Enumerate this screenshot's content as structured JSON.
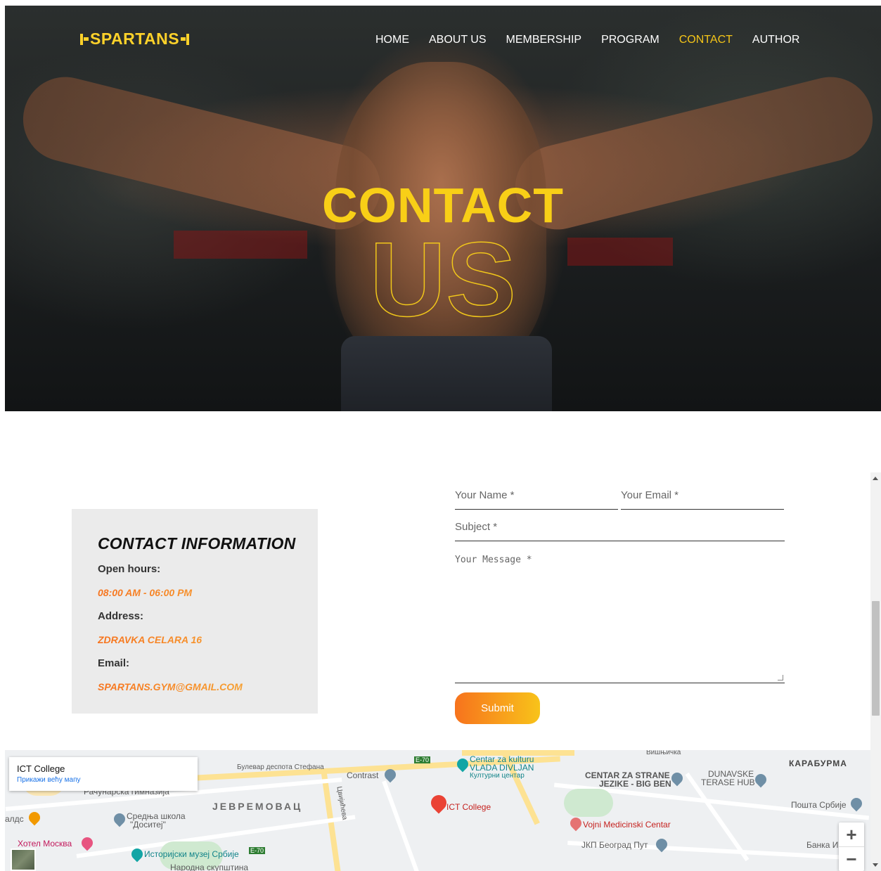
{
  "brand": {
    "name": "SPARTANS"
  },
  "nav": {
    "items": [
      {
        "label": "HOME",
        "active": false
      },
      {
        "label": "ABOUT US",
        "active": false
      },
      {
        "label": "MEMBERSHIP",
        "active": false
      },
      {
        "label": "PROGRAM",
        "active": false
      },
      {
        "label": "CONTACT",
        "active": true
      },
      {
        "label": "AUTHOR",
        "active": false
      }
    ]
  },
  "hero": {
    "line1": "CONTACT",
    "line2": "US"
  },
  "contact_info": {
    "title": "CONTACT INFORMATION",
    "hours_label": "Open hours:",
    "hours_value": "08:00 AM - 06:00 PM",
    "address_label": "Address:",
    "address_value": "ZDRAVKA CELARA 16",
    "email_label": "Email:",
    "email_value": "SPARTANS.GYM@GMAIL.COM"
  },
  "form": {
    "name_placeholder": "Your Name *",
    "email_placeholder": "Your Email *",
    "subject_placeholder": "Subject *",
    "message_placeholder": "Your Message *",
    "submit_label": "Submit"
  },
  "map": {
    "card_title": "ICT College",
    "card_link": "Прикажи већу мапу",
    "zoom_in": "+",
    "zoom_out": "−",
    "labels": {
      "marker": "ICT College",
      "bulevar": "Булевар деспота Стефана",
      "e70a": "E-70",
      "e70b": "E-70",
      "vlada1": "Centar za kulturu",
      "vlada2": "VLADA DIVLJAN",
      "vlada3": "Културни центар",
      "contrast": "Contrast",
      "centar1": "CENTAR ZA STRANE",
      "centar2": "JEZIKE - BIG BEN",
      "dunav1": "DUNAVSKE",
      "dunav2": "TERASE HUB",
      "karaburma": "КАРАБУРМА",
      "posta": "Пошта Србије",
      "gimn": "Рачунарска гимназија",
      "jevrem": "ЈЕВРЕМОВАЦ",
      "srednja1": "Средња школа",
      "srednja2": "\"Доситеј\"",
      "hotel": "Хотел Москва",
      "muzej": "Историјски музеј Србије",
      "vojni": "Vojni Medicinski Centar",
      "jkp": "ЈКП Београд Пут",
      "banka": "Банка И",
      "cvijiceva": "Цвијићева",
      "visnjicka": "Вишњичка",
      "narodna": "Народна скупштина",
      "maldс": "алдс"
    }
  }
}
